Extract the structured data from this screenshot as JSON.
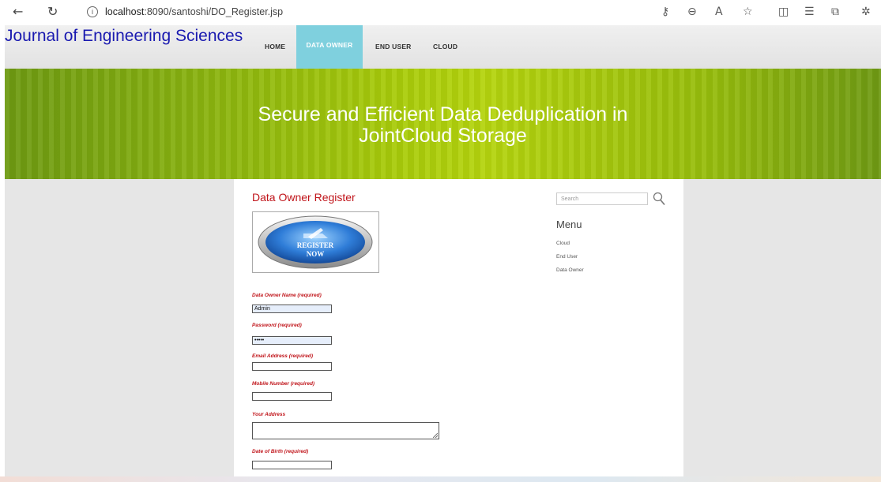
{
  "browser": {
    "back_icon": "arrow-left-icon",
    "reload_icon": "reload-icon",
    "url_host": "localhost",
    "url_path": ":8090/santoshi/DO_Register.jsp"
  },
  "journal_title": "Journal of Engineering Sciences",
  "nav": {
    "home": "HOME",
    "data_owner": "DATA OWNER",
    "end_user": "END USER",
    "cloud": "CLOUD",
    "active_color": "#7fd0de"
  },
  "banner": {
    "line1": "Secure and Efficient Data Deduplication in",
    "line2": "JointCloud Storage"
  },
  "form": {
    "title": "Data Owner Register",
    "image_text_1": "REGISTER",
    "image_text_2": "NOW",
    "name_label": "Data Owner Name (required)",
    "name_value": "Admin",
    "password_label": "Password (required)",
    "password_value": "•••••",
    "email_label": "Email Address (required)",
    "email_value": "",
    "mobile_label": "Mobile Number (required)",
    "mobile_value": "",
    "address_label": "Your Address",
    "dob_label": "Date of Birth (required)",
    "accent_color": "#c0141a"
  },
  "sidebar": {
    "search_placeholder": "Search",
    "menu_title": "Menu",
    "items": [
      "Cloud",
      "End User",
      "Data Owner"
    ]
  }
}
